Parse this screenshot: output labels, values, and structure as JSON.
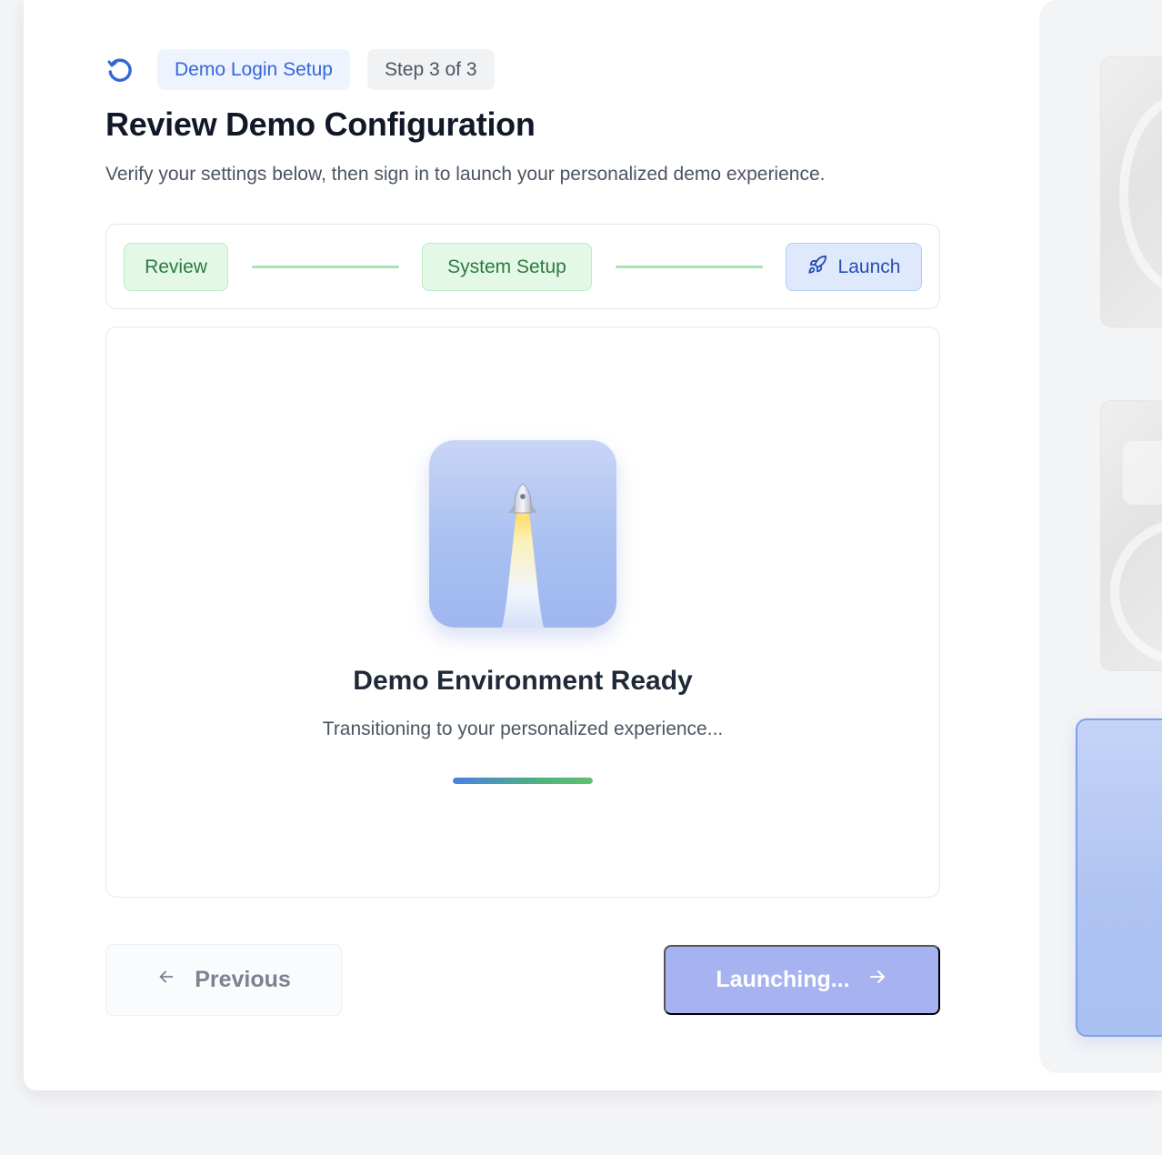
{
  "header": {
    "badge_label": "Demo Login Setup",
    "step_indicator": "Step 3 of 3",
    "title": "Review Demo Configuration",
    "subtitle": "Verify your settings below, then sign in to launch your personalized demo experience."
  },
  "stepper": {
    "steps": [
      {
        "label": "Review",
        "status": "complete"
      },
      {
        "label": "System Setup",
        "status": "complete"
      },
      {
        "label": "Launch",
        "status": "current",
        "icon": "rocket-icon"
      }
    ]
  },
  "launch_panel": {
    "title": "Demo Environment Ready",
    "message": "Transitioning to your personalized experience...",
    "progress_fraction": 1.0
  },
  "footer": {
    "previous_label": "Previous",
    "launch_label": "Launching..."
  },
  "colors": {
    "accent": "#3467d6",
    "success": "#2f7a3f",
    "primary_button_disabled": "#a6b3f0"
  }
}
